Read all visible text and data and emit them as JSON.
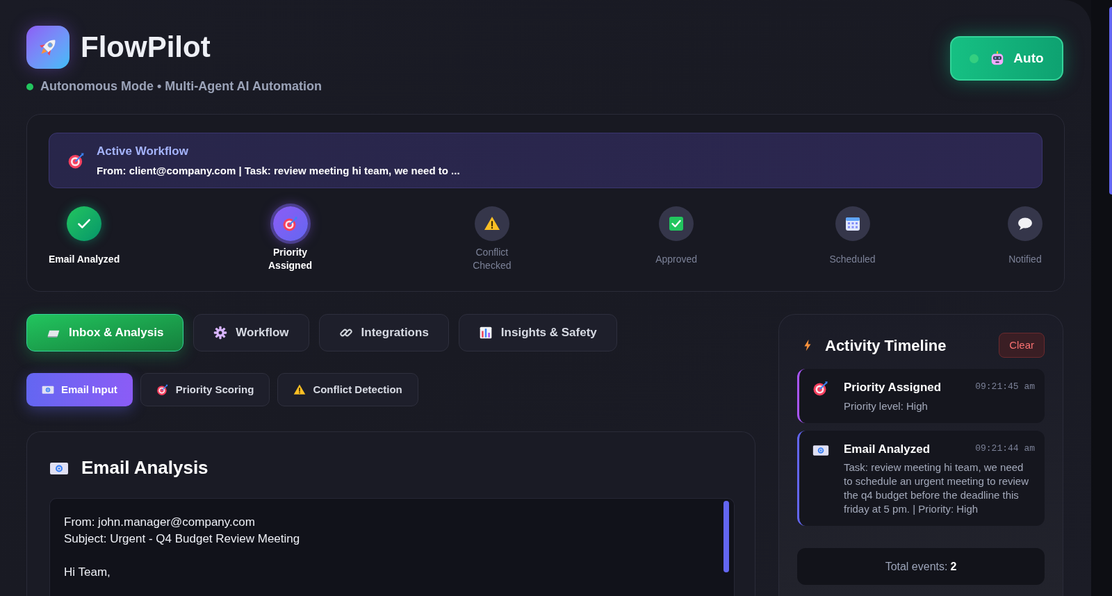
{
  "app": {
    "name": "FlowPilot",
    "subtitle": "Autonomous Mode • Multi-Agent AI Automation",
    "online": true
  },
  "mode_button": {
    "label": "Auto",
    "on": true
  },
  "active_workflow": {
    "title": "Active Workflow",
    "detail": "From: client@company.com | Task: review meeting hi team, we need to ..."
  },
  "steps": [
    {
      "label": "Email Analyzed",
      "done": true,
      "active": false
    },
    {
      "label": "Priority Assigned",
      "done": false,
      "active": true
    },
    {
      "label": "Conflict Checked",
      "done": false,
      "active": false
    },
    {
      "label": "Approved",
      "done": false,
      "active": false
    },
    {
      "label": "Scheduled",
      "done": false,
      "active": false
    },
    {
      "label": "Notified",
      "done": false,
      "active": false
    }
  ],
  "tabs": [
    {
      "label": "Inbox & Analysis",
      "selected": true
    },
    {
      "label": "Workflow",
      "selected": false
    },
    {
      "label": "Integrations",
      "selected": false
    },
    {
      "label": "Insights & Safety",
      "selected": false
    }
  ],
  "subtabs": [
    {
      "label": "Email Input",
      "selected": true
    },
    {
      "label": "Priority Scoring",
      "selected": false
    },
    {
      "label": "Conflict Detection",
      "selected": false
    }
  ],
  "email_analysis": {
    "title": "Email Analysis",
    "input": {
      "value": "From: john.manager@company.com\nSubject: Urgent - Q4 Budget Review Meeting\n\nHi Team,"
    }
  },
  "timeline": {
    "title": "Activity Timeline",
    "clear_button": "Clear",
    "events": [
      {
        "kind": "priority",
        "title": "Priority Assigned",
        "time": "09:21:45 am",
        "detail": "Priority level: High",
        "color": "#a855f7"
      },
      {
        "kind": "email",
        "title": "Email Analyzed",
        "time": "09:21:44 am",
        "detail": "Task: review meeting hi team, we need to schedule an urgent meeting to review the q4 budget before the deadline this friday at 5 pm. | Priority: High",
        "color": "#6366f1"
      }
    ],
    "total": "Total events: **2**"
  }
}
